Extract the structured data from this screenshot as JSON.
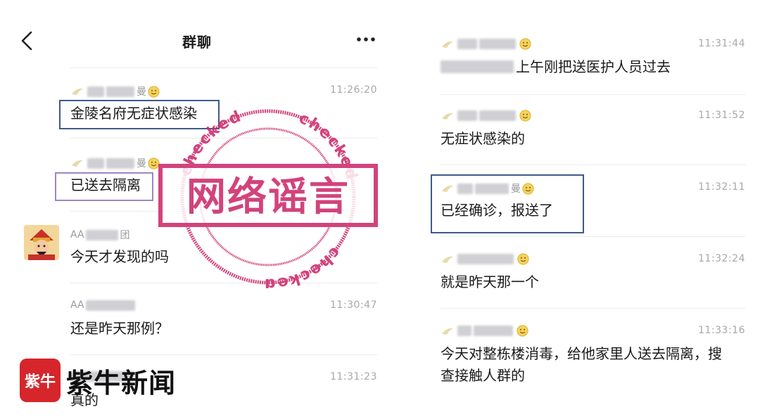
{
  "left_screen": {
    "header": {
      "title": "群聊",
      "back_icon": "chevron-left-icon",
      "more_icon": "more-dots-icon"
    },
    "messages": [
      {
        "nick_suffix": "曼",
        "time": "11:26:20",
        "text": "金陵名府无症状感染"
      },
      {
        "nick_suffix": "曼",
        "time": "",
        "text": "已送去隔离"
      },
      {
        "nick_prefix": "AA",
        "nick_suffix": "团",
        "time": "",
        "text": "今天才发现的吗"
      },
      {
        "nick_prefix": "AA",
        "time": "11:30:47",
        "text": "还是昨天那例？"
      },
      {
        "time": "11:31:23",
        "text": "真的"
      }
    ],
    "stamp": {
      "main_text": "网络谣言",
      "ring_text": "checked",
      "color": "#cc2a6b"
    },
    "logo": {
      "text": "紫牛新闻",
      "mark_text": "紫牛",
      "color": "#d6262b"
    }
  },
  "right_screen": {
    "messages": [
      {
        "time": "11:31:44",
        "text": "上午刚把送医护人员过去"
      },
      {
        "time": "11:31:52",
        "text": "无症状感染的"
      },
      {
        "nick_suffix": "曼",
        "time": "11:32:11",
        "text": "已经确诊，报送了"
      },
      {
        "time": "11:32:24",
        "text": "就是昨天那一个"
      },
      {
        "time": "11:33:16",
        "text": "今天对整栋楼消毒，给他家里人送去隔离，搜查接触人群的"
      }
    ]
  },
  "colors": {
    "highlight_blue": "#3f5a8a",
    "highlight_purple": "#9c87c4",
    "divider": "#ececec",
    "timestamp": "#a8a8a8"
  }
}
